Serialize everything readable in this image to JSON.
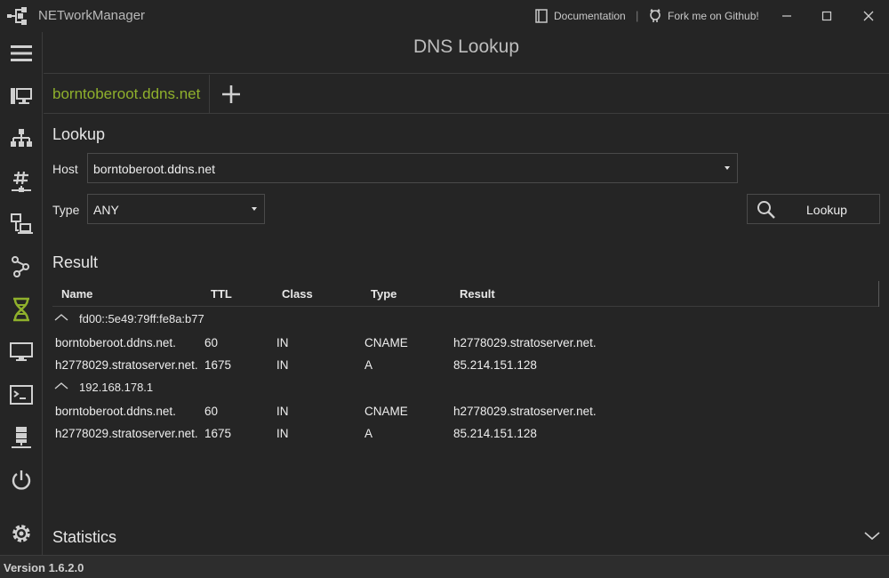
{
  "app": {
    "title": "NETworkManager",
    "version": "Version 1.6.2.0",
    "accent": "#8fb02c"
  },
  "titlebar": {
    "documentation_label": "Documentation",
    "github_label": "Fork me on Github!",
    "separator": "|"
  },
  "header": {
    "title": "DNS Lookup"
  },
  "tabs": [
    {
      "label": "borntoberoot.ddns.net",
      "active": true
    }
  ],
  "sidebar": {
    "items": [
      {
        "icon": "hamburger-menu-icon"
      },
      {
        "icon": "network-interface-icon"
      },
      {
        "icon": "network-topology-icon"
      },
      {
        "icon": "subnet-hash-icon"
      },
      {
        "icon": "computers-icon"
      },
      {
        "icon": "traceroute-icon"
      },
      {
        "icon": "dns-lookup-icon",
        "active": true
      },
      {
        "icon": "monitor-icon"
      },
      {
        "icon": "terminal-icon"
      },
      {
        "icon": "server-icon"
      },
      {
        "icon": "power-icon"
      },
      {
        "icon": "settings-gear-icon"
      }
    ]
  },
  "lookup": {
    "section_title": "Lookup",
    "host_label": "Host",
    "host_value": "borntoberoot.ddns.net",
    "type_label": "Type",
    "type_value": "ANY",
    "button_label": "Lookup"
  },
  "result": {
    "section_title": "Result",
    "columns": [
      "Name",
      "TTL",
      "Class",
      "Type",
      "Result"
    ],
    "groups": [
      {
        "server": "fd00::5e49:79ff:fe8a:b77",
        "rows": [
          {
            "name": "borntoberoot.ddns.net.",
            "ttl": "60",
            "class": "IN",
            "type": "CNAME",
            "result": "h2778029.stratoserver.net."
          },
          {
            "name": "h2778029.stratoserver.net.",
            "ttl": "1675",
            "class": "IN",
            "type": "A",
            "result": "85.214.151.128"
          }
        ]
      },
      {
        "server": "192.168.178.1",
        "rows": [
          {
            "name": "borntoberoot.ddns.net.",
            "ttl": "60",
            "class": "IN",
            "type": "CNAME",
            "result": "h2778029.stratoserver.net."
          },
          {
            "name": "h2778029.stratoserver.net.",
            "ttl": "1675",
            "class": "IN",
            "type": "A",
            "result": "85.214.151.128"
          }
        ]
      }
    ]
  },
  "statistics": {
    "label": "Statistics"
  }
}
